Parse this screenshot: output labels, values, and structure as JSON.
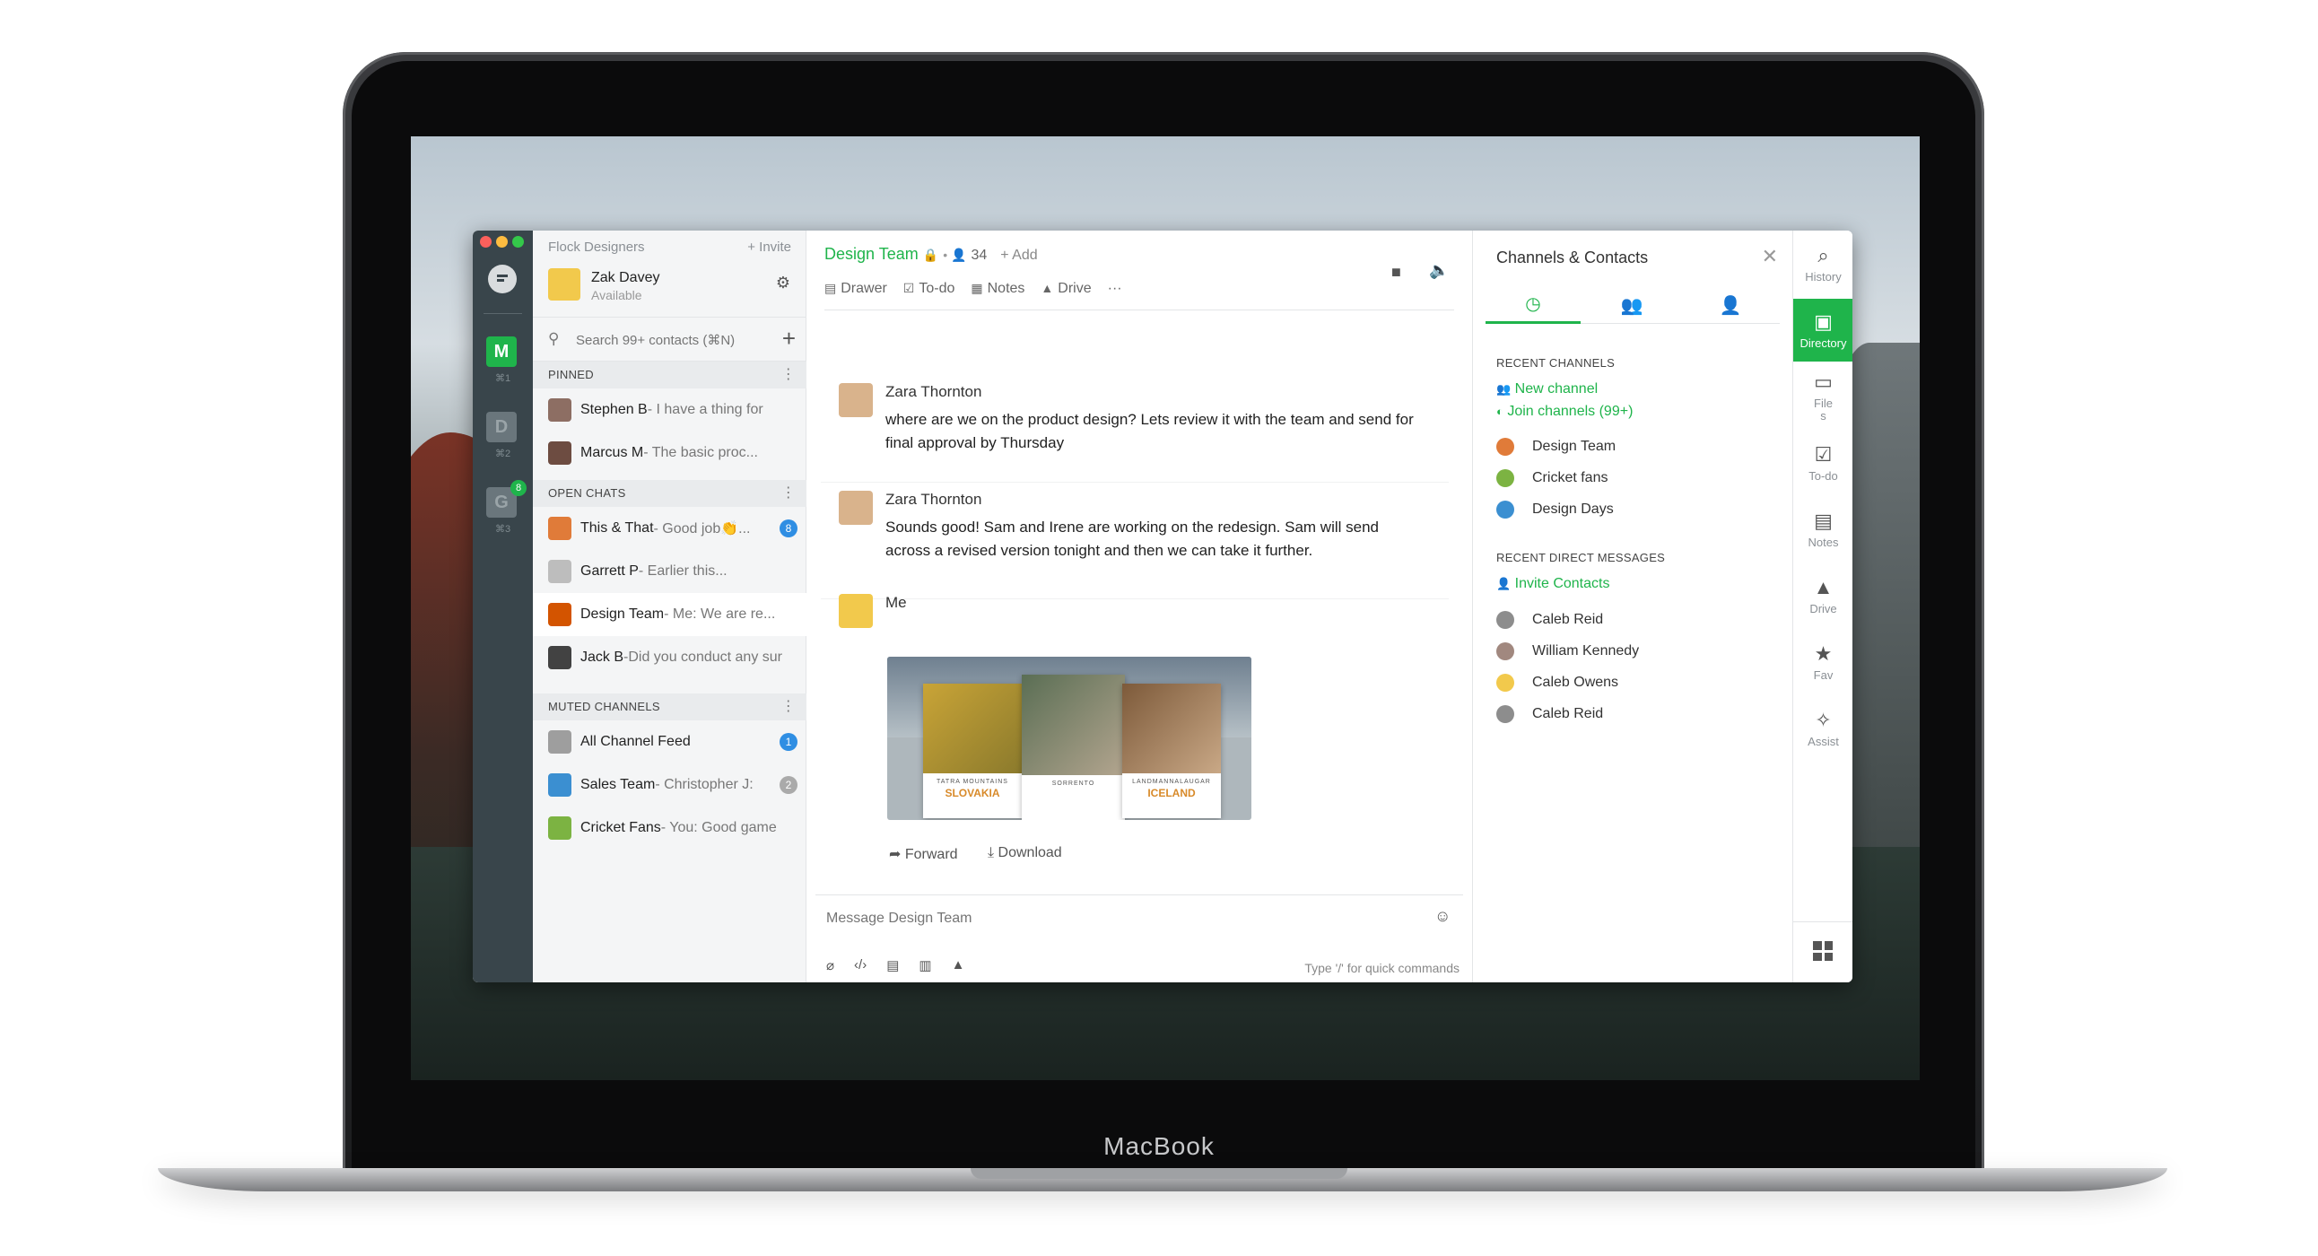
{
  "device": {
    "brand": "MacBook"
  },
  "colors": {
    "accent": "#1fb44b",
    "rail": "#39454b",
    "badge": "#2f8ee3"
  },
  "rail": {
    "workspaces": [
      {
        "letter": "M",
        "shortcut": "⌘1",
        "color": "#1fb44b"
      },
      {
        "letter": "D",
        "shortcut": "⌘2",
        "color": "#6a767c"
      },
      {
        "letter": "G",
        "shortcut": "⌘3",
        "color": "#6a767c",
        "badge": "8"
      }
    ]
  },
  "sidebar": {
    "team": "Flock Designers",
    "invite": "+ Invite",
    "user": {
      "name": "Zak Davey",
      "status": "Available"
    },
    "search_placeholder": "Search 99+ contacts (⌘N)",
    "pinned": {
      "title": "PINNED",
      "items": [
        {
          "name": "Stephen B",
          "preview": "- I have a thing for"
        },
        {
          "name": "Marcus M",
          "preview": "- The basic proc..."
        }
      ]
    },
    "open": {
      "title": "OPEN CHATS",
      "items": [
        {
          "name": "This & That",
          "preview": "- Good job👏...",
          "badge": "8"
        },
        {
          "name": "Garrett P",
          "preview": "- Earlier this..."
        },
        {
          "name": "Design Team",
          "preview": "- Me: We are re..."
        },
        {
          "name": "Jack B",
          "preview": " -Did you conduct any sur"
        }
      ]
    },
    "muted": {
      "title": "MUTED CHANNELS",
      "items": [
        {
          "name": "All Channel Feed",
          "preview": "",
          "badge": "1"
        },
        {
          "name": "Sales Team",
          "preview": "- Christopher J:",
          "badge": "2"
        },
        {
          "name": "Cricket Fans",
          "preview": "- You: Good game"
        }
      ]
    }
  },
  "chat": {
    "channel": "Design Team",
    "members": "34",
    "add": "+ Add",
    "tools": [
      "Drawer",
      "To-do",
      "Notes",
      "Drive"
    ],
    "messages": [
      {
        "author": "Zara Thornton",
        "text": "where are we on the product design? Lets review it with the team and send for final approval by Thursday"
      },
      {
        "author": "Zara Thornton",
        "text": "Sounds good! Sam and Irene are working on the redesign. Sam will send across a revised version tonight and then we can take it further."
      },
      {
        "author": "Me",
        "text": ""
      }
    ],
    "attachment": {
      "cards": [
        {
          "title": "SLOVAKIA",
          "kicker": "TATRA MOUNTAINS"
        },
        {
          "title": "",
          "kicker": "SORRENTO"
        },
        {
          "title": "ICELAND",
          "kicker": "LANDMANNALAUGAR"
        }
      ],
      "forward": "Forward",
      "download": "Download"
    },
    "composer": {
      "placeholder": "Message Design Team",
      "hint": "Type '/' for quick commands"
    }
  },
  "rpanel": {
    "title": "Channels & Contacts",
    "recent_channels_title": "RECENT CHANNELS",
    "new_channel": "New channel",
    "join_channels": "Join channels (99+)",
    "channels": [
      "Design Team",
      "Cricket fans",
      "Design Days"
    ],
    "recent_dm_title": "RECENT DIRECT MESSAGES",
    "invite_contacts": "Invite Contacts",
    "contacts": [
      "Caleb Reid",
      "William Kennedy",
      "Caleb Owens",
      "Caleb Reid"
    ]
  },
  "nav": {
    "items": [
      {
        "label": "History",
        "icon": "search-icon"
      },
      {
        "label": "Directory",
        "icon": "directory-icon",
        "active": true
      },
      {
        "label": "File\ns",
        "icon": "files-icon"
      },
      {
        "label": "To-do",
        "icon": "todo-icon"
      },
      {
        "label": "Notes",
        "icon": "notes-icon"
      },
      {
        "label": "Drive",
        "icon": "drive-icon"
      },
      {
        "label": "Fav",
        "icon": "star-icon"
      },
      {
        "label": "Assist",
        "icon": "magic-icon"
      }
    ]
  }
}
